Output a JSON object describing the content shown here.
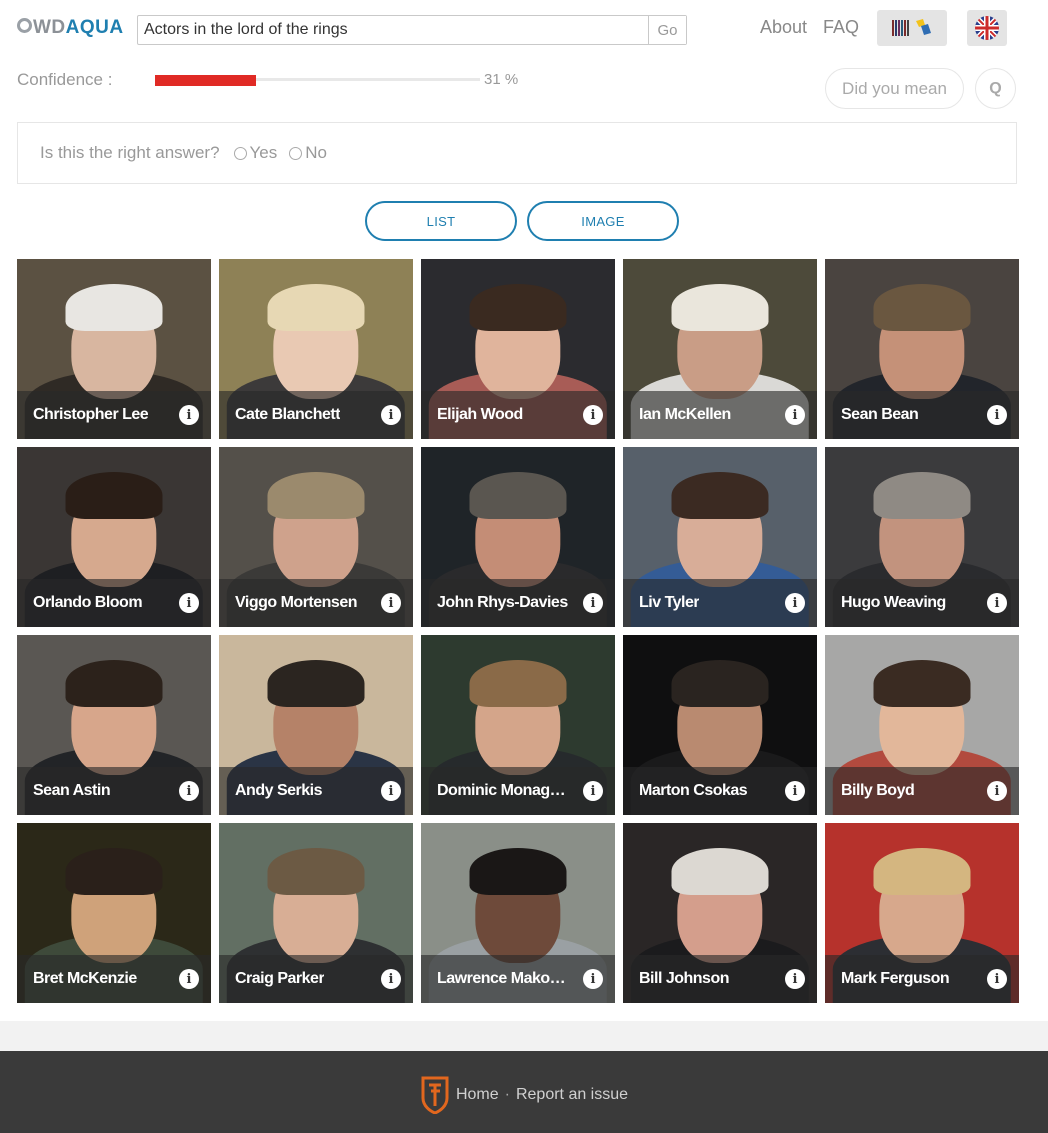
{
  "header": {
    "logo_wd": "WD",
    "logo_aqua": "AQUA",
    "search_value": "Actors in the lord of the rings",
    "go_label": "Go",
    "nav_about": "About",
    "nav_faq": "FAQ"
  },
  "confidence": {
    "label": "Confidence :",
    "percent": 31,
    "value_text": "31 %",
    "bar_color": "#e02a25"
  },
  "actions": {
    "did_you_mean": "Did you mean",
    "q_label": "Q"
  },
  "feedback": {
    "question": "Is this the right answer?",
    "yes": "Yes",
    "no": "No"
  },
  "views": {
    "list": "LIST",
    "image": "IMAGE"
  },
  "results": [
    {
      "name": "Christopher Lee",
      "bg": "#5b5142",
      "skin": "#d8b6a0",
      "hair": "#e8e6e2",
      "clothes": "#2f2a25"
    },
    {
      "name": "Cate Blanchett",
      "bg": "#8e8156",
      "skin": "#e9c9b3",
      "hair": "#e7d8b4",
      "clothes": "#3c3a3a"
    },
    {
      "name": "Elijah Wood",
      "bg": "#2b2b2f",
      "skin": "#e0b49c",
      "hair": "#3a2a20",
      "clothes": "#a85c56"
    },
    {
      "name": "Ian McKellen",
      "bg": "#4d4a3a",
      "skin": "#c99d86",
      "hair": "#eae6dc",
      "clothes": "#dad9d6"
    },
    {
      "name": "Sean Bean",
      "bg": "#4a4440",
      "skin": "#c59178",
      "hair": "#6a5740",
      "clothes": "#22252b"
    },
    {
      "name": "Orlando Bloom",
      "bg": "#3a3634",
      "skin": "#d6a98e",
      "hair": "#2a1e17",
      "clothes": "#1e1f22"
    },
    {
      "name": "Viggo Mortensen",
      "bg": "#54504a",
      "skin": "#cfa28c",
      "hair": "#9b8a6d",
      "clothes": "#3b3a38"
    },
    {
      "name": "John Rhys-Davies",
      "bg": "#1f2428",
      "skin": "#c48d76",
      "hair": "#5a5650",
      "clothes": "#2a2a2c"
    },
    {
      "name": "Liv Tyler",
      "bg": "#57606a",
      "skin": "#d8ad98",
      "hair": "#3b2a22",
      "clothes": "#345c96"
    },
    {
      "name": "Hugo Weaving",
      "bg": "#3b3b3d",
      "skin": "#c2937e",
      "hair": "#8f8a84",
      "clothes": "#2a2b2e"
    },
    {
      "name": "Sean Astin",
      "bg": "#5a5753",
      "skin": "#d7a68b",
      "hair": "#2c221b",
      "clothes": "#222427"
    },
    {
      "name": "Andy Serkis",
      "bg": "#c9b79c",
      "skin": "#b58268",
      "hair": "#2b2520",
      "clothes": "#2a3445"
    },
    {
      "name": "Dominic Monaghan",
      "bg": "#2d3a2f",
      "skin": "#d4a58a",
      "hair": "#8a6a48",
      "clothes": "#262a2c"
    },
    {
      "name": "Marton Csokas",
      "bg": "#0f0f10",
      "skin": "#b98a70",
      "hair": "#2a2420",
      "clothes": "#1a1a1b"
    },
    {
      "name": "Billy Boyd",
      "bg": "#a7a7a6",
      "skin": "#e2b79a",
      "hair": "#3a2b22",
      "clothes": "#b24a3e"
    },
    {
      "name": "Bret McKenzie",
      "bg": "#2b2818",
      "skin": "#cfa27a",
      "hair": "#2a201a",
      "clothes": "#3e4a3a"
    },
    {
      "name": "Craig Parker",
      "bg": "#626f63",
      "skin": "#d8ae95",
      "hair": "#6c5a44",
      "clothes": "#2e3032"
    },
    {
      "name": "Lawrence Makoare",
      "bg": "#8a8f88",
      "skin": "#6e4a3a",
      "hair": "#1a1716",
      "clothes": "#9aa0a3"
    },
    {
      "name": "Bill Johnson",
      "bg": "#2a2626",
      "skin": "#d49e8c",
      "hair": "#dcd8d2",
      "clothes": "#1b1b1d"
    },
    {
      "name": "Mark Ferguson",
      "bg": "#b6322c",
      "skin": "#d7a88c",
      "hair": "#d4b680",
      "clothes": "#2c2e33"
    }
  ],
  "footer": {
    "home": "Home",
    "separator": "·",
    "report": "Report an issue"
  }
}
